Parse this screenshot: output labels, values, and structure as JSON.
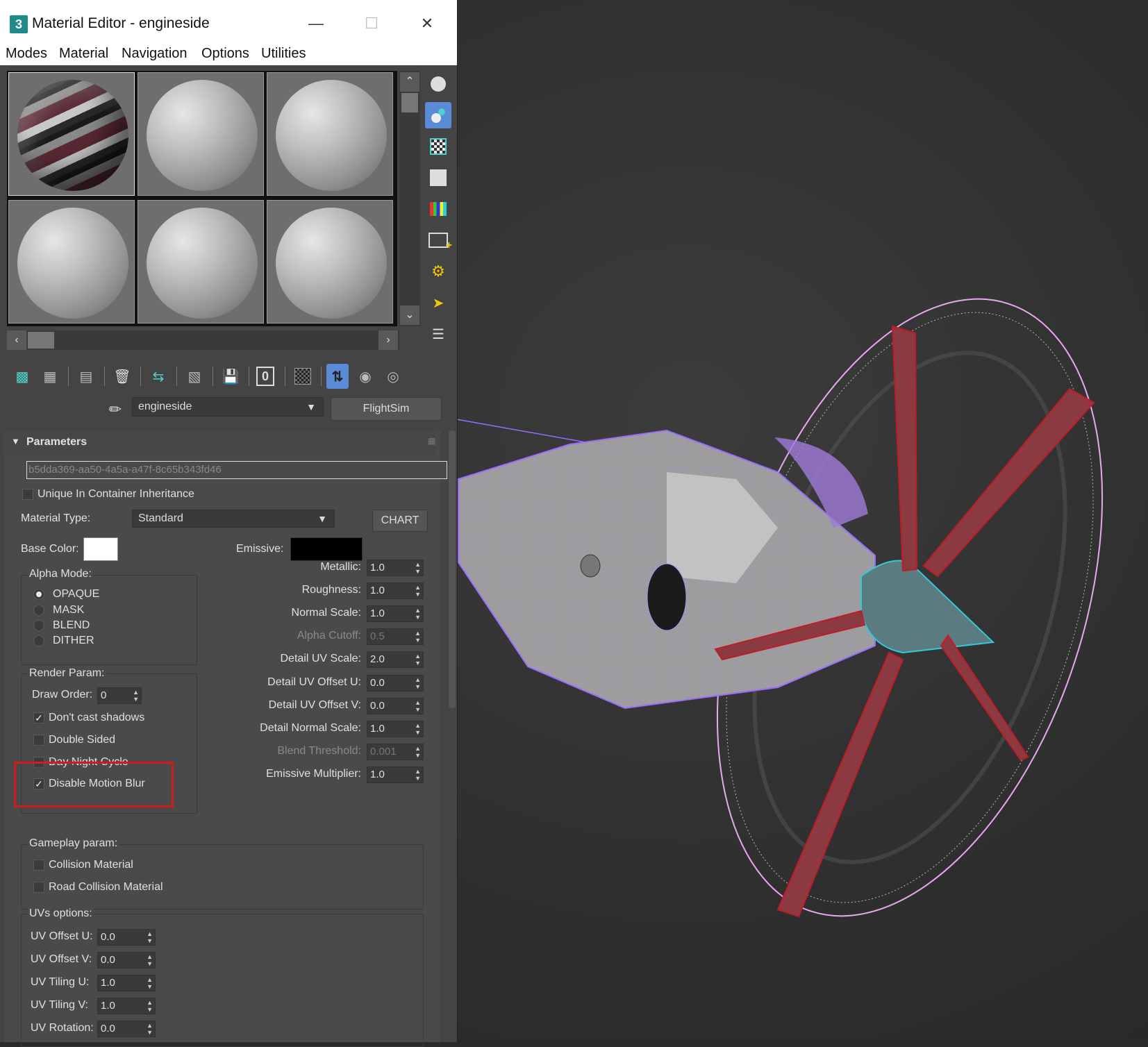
{
  "window": {
    "title": "Material Editor - engineside",
    "app_icon_text": "3",
    "min_label": "—",
    "max_label": "☐",
    "close_label": "✕"
  },
  "menu": [
    "Modes",
    "Material",
    "Navigation",
    "Options",
    "Utilities"
  ],
  "material_selector": {
    "name": "engineside",
    "button": "FlightSim"
  },
  "parameters": {
    "header": "Parameters",
    "guid": "b5dda369-aa50-4a5a-a47f-8c65b343fd46",
    "unique_label": "Unique In Container Inheritance",
    "material_type_label": "Material Type:",
    "material_type_value": "Standard",
    "chart_button": "CHART",
    "base_color_label": "Base Color:",
    "base_color": "#ffffff",
    "emissive_label": "Emissive:",
    "emissive_color": "#000000",
    "alpha_mode": {
      "label": "Alpha Mode:",
      "options": [
        "OPAQUE",
        "MASK",
        "BLEND",
        "DITHER"
      ],
      "selected": "OPAQUE"
    },
    "render_param": {
      "label": "Render Param:",
      "draw_order_label": "Draw Order:",
      "draw_order_value": "0",
      "dont_cast_shadows": "Don't cast shadows",
      "double_sided": "Double Sided",
      "day_night_cycle": "Day Night Cycle",
      "disable_motion_blur": "Disable Motion Blur"
    },
    "numeric": [
      {
        "label": "Metallic:",
        "value": "1.0",
        "enabled": true
      },
      {
        "label": "Roughness:",
        "value": "1.0",
        "enabled": true
      },
      {
        "label": "Normal Scale:",
        "value": "1.0",
        "enabled": true
      },
      {
        "label": "Alpha Cutoff:",
        "value": "0.5",
        "enabled": false
      },
      {
        "label": "Detail UV Scale:",
        "value": "2.0",
        "enabled": true
      },
      {
        "label": "Detail UV Offset U:",
        "value": "0.0",
        "enabled": true
      },
      {
        "label": "Detail UV Offset V:",
        "value": "0.0",
        "enabled": true
      },
      {
        "label": "Detail Normal Scale:",
        "value": "1.0",
        "enabled": true
      },
      {
        "label": "Blend Threshold:",
        "value": "0.001",
        "enabled": false
      },
      {
        "label": "Emissive Multiplier:",
        "value": "1.0",
        "enabled": true
      }
    ],
    "gameplay": {
      "label": "Gameplay param:",
      "collision": "Collision Material",
      "road_collision": "Road Collision Material"
    },
    "uvs": {
      "label": "UVs options:",
      "items": [
        {
          "label": "UV Offset U:",
          "value": "0.0"
        },
        {
          "label": "UV Offset V:",
          "value": "0.0"
        },
        {
          "label": "UV Tiling U:",
          "value": "1.0"
        },
        {
          "label": "UV Tiling V:",
          "value": "1.0"
        },
        {
          "label": "UV Rotation:",
          "value": "0.0"
        }
      ]
    }
  },
  "colors": {
    "highlight": "#d01c1c",
    "accent": "#4a90d9",
    "wire_purple": "#9a6bff",
    "wire_red": "#c01c28",
    "wire_cyan": "#35c8d8"
  }
}
